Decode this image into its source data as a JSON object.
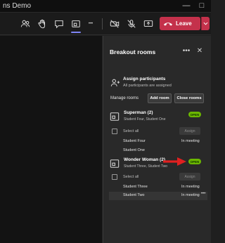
{
  "window": {
    "title": "ns Demo",
    "minimize_glyph": "—",
    "maximize_glyph": "□"
  },
  "toolbar": {
    "icons": [
      "people-icon",
      "raise-hand-icon",
      "react-icon",
      "breakout-rooms-icon",
      "more-icon",
      "camera-off-icon",
      "mic-off-icon",
      "share-screen-icon"
    ],
    "leave_label": "Leave",
    "more_glyph": "•••"
  },
  "panel": {
    "title": "Breakout rooms",
    "more_glyph": "•••",
    "close_glyph": "✕",
    "assign": {
      "title": "Assign participants",
      "subtitle": "All participants are assigned"
    },
    "manage_label": "Manage rooms",
    "add_room_label": "Add room",
    "close_rooms_label": "Close rooms",
    "rooms": [
      {
        "name": "Superman (2)",
        "subtitle": "Student Four, Student One",
        "status": "OPEN",
        "select_all_label": "Select all",
        "assign_label": "Assign",
        "students": [
          {
            "name": "Student Four",
            "status": "In meeting"
          },
          {
            "name": "Student One",
            "status": ""
          }
        ]
      },
      {
        "name": "Wonder Woman (2)",
        "subtitle": "Student Three, Student Two",
        "status": "OPEN",
        "select_all_label": "Select all",
        "assign_label": "Assign",
        "students": [
          {
            "name": "Student Three",
            "status": "In meeting"
          },
          {
            "name": "Student Two",
            "status": "In meeting"
          }
        ]
      }
    ],
    "row_more_glyph": "•••"
  },
  "colors": {
    "leave": "#c4314b",
    "open_badge": "#6bb700",
    "accent": "#7f85f5",
    "annotation_arrow": "#e02020"
  }
}
